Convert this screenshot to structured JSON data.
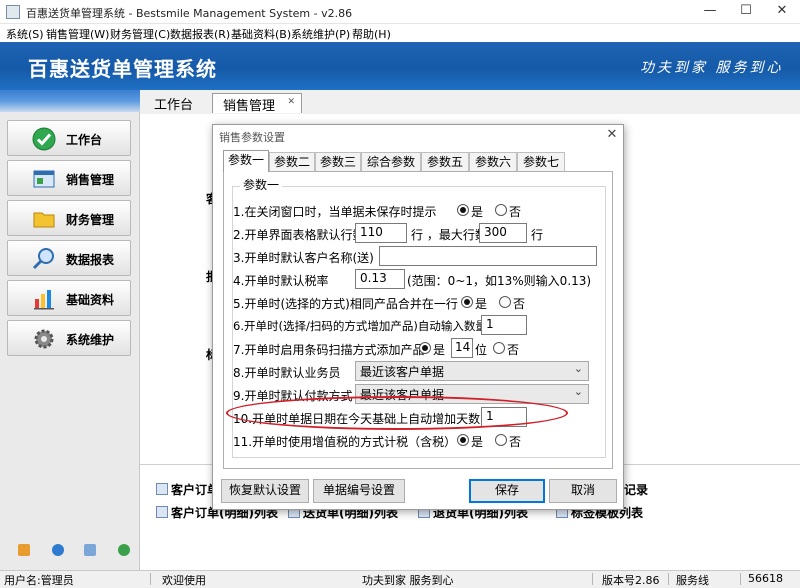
{
  "window": {
    "title": "百惠送货单管理系统 - Bestsmile Management System - v2.86",
    "minimize": "—",
    "maximize": "☐",
    "close": "✕"
  },
  "menu": [
    "系统(S)",
    "销售管理(W)",
    "财务管理(C)",
    "数据报表(R)",
    "基础资料(B)",
    "系统维护(P)",
    "帮助(H)"
  ],
  "banner": {
    "title": "百惠送货单管理系统",
    "slogan": "功夫到家 服务到心"
  },
  "nav": [
    {
      "label": "工作台",
      "icon": "check-circle-icon"
    },
    {
      "label": "销售管理",
      "icon": "window-icon"
    },
    {
      "label": "财务管理",
      "icon": "folder-icon"
    },
    {
      "label": "数据报表",
      "icon": "magnifier-icon"
    },
    {
      "label": "基础资料",
      "icon": "bar-chart-icon"
    },
    {
      "label": "系统维护",
      "icon": "gear-icon"
    }
  ],
  "tabs": {
    "workbench": "工作台",
    "sales": "销售管理",
    "close": "✕"
  },
  "background": {
    "partial_labels": [
      "客",
      "批",
      "标"
    ],
    "row1_left": "客户订单",
    "row1_right": "记录",
    "row2": [
      "客户订单(明细)列表",
      "送货单(明细)列表",
      "退货单(明细)列表",
      "标签模板列表"
    ]
  },
  "dialog": {
    "title": "销售参数设置",
    "close": "✕",
    "tabs": [
      "参数一",
      "参数二",
      "参数三",
      "综合参数",
      "参数五",
      "参数六",
      "参数七"
    ],
    "active_tab": "参数一",
    "group_label": "参数一",
    "rows": {
      "r1": {
        "label": "1.在关闭窗口时，当单据未保存时提示",
        "yes": "是",
        "no": "否",
        "selected": "是"
      },
      "r2": {
        "label": "2.开单界面表格默认行数",
        "rows_value": "110",
        "mid": "行 ，最大行数",
        "max_value": "300",
        "suffix": "行"
      },
      "r3": {
        "label": "3.开单时默认客户名称(送)",
        "value": ""
      },
      "r4": {
        "label": "4.开单时默认税率",
        "value": "0.13",
        "hint": "(范围：0~1，如13%则输入0.13)"
      },
      "r5": {
        "label": "5.开单时(选择的方式)相同产品合并在一行",
        "yes": "是",
        "no": "否",
        "selected": "是"
      },
      "r6": {
        "label": "6.开单时(选择/扫码的方式增加产品)自动输入数量",
        "value": "1"
      },
      "r7": {
        "label": "7.开单时启用条码扫描方式添加产品",
        "yes": "是",
        "digits": "14",
        "unit": "位",
        "no": "否",
        "selected": "是"
      },
      "r8": {
        "label": "8.开单时默认业务员",
        "value": "最近该客户单据"
      },
      "r9": {
        "label": "9.开单时默认付款方式",
        "value": "最近该客户单据"
      },
      "r10": {
        "label": "10.开单时单据日期在今天基础上自动增加天数(送)",
        "value": "1"
      },
      "r11": {
        "label": "11.开单时使用增值税的方式计税（含税）",
        "yes": "是",
        "no": "否",
        "selected": "是"
      }
    },
    "buttons": {
      "restore": "恢复默认设置",
      "numbering": "单据编号设置",
      "save": "保存",
      "cancel": "取消"
    }
  },
  "status": {
    "user": "用户名:管理员",
    "welcome": "欢迎使用",
    "slogan": "功夫到家 服务到心",
    "version": "版本号2.86",
    "service": "服务线",
    "id": "56618"
  },
  "colors": {
    "banner": "#155aa8",
    "highlight": "#d0202a",
    "default_button": "#0078d7"
  }
}
